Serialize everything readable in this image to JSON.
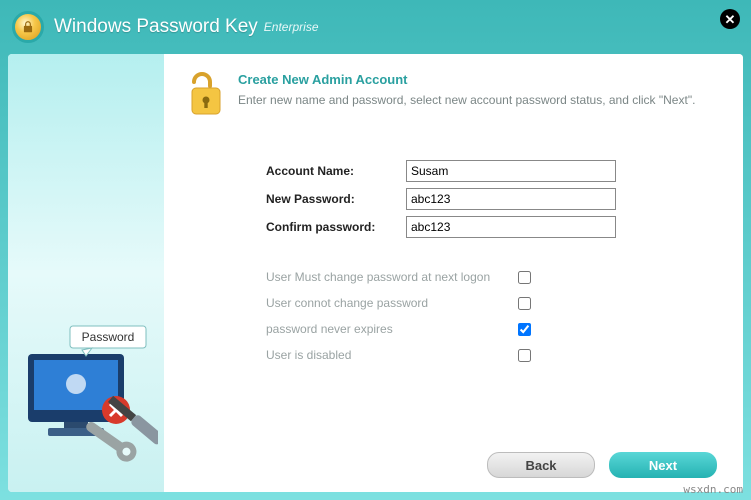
{
  "app": {
    "title": "Windows Password Key",
    "edition": "Enterprise"
  },
  "header": {
    "title": "Create New Admin Account",
    "desc": "Enter new name and password, select new account password status, and click \"Next\"."
  },
  "fields": {
    "account_label": "Account Name:",
    "account_value": "Susam",
    "newpw_label": "New Password:",
    "newpw_value": "abc123",
    "confirm_label": "Confirm password:",
    "confirm_value": "abc123"
  },
  "options": {
    "must_change": {
      "label": "User Must change password at next logon",
      "checked": false
    },
    "cannot_change": {
      "label": "User connot change password",
      "checked": false
    },
    "never_expires": {
      "label": "password never expires",
      "checked": true
    },
    "disabled": {
      "label": "User is disabled",
      "checked": false
    }
  },
  "buttons": {
    "back": "Back",
    "next": "Next"
  },
  "sidebar": {
    "badge_text": "Password"
  },
  "watermark": "wsxdn.com"
}
